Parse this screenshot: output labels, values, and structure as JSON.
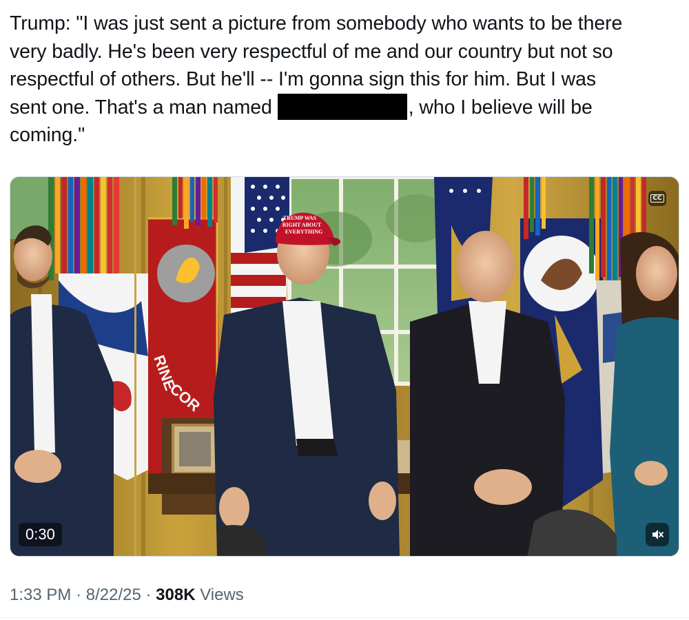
{
  "tweet": {
    "text_line1": "Trump: \"I was just sent a picture from somebody who wants to be there",
    "text_line2": "very badly. He's been very respectful of me and our country but not so",
    "text_line3": "respectful of others. But he'll -- I'm gonna sign this for him. But I was",
    "text_line4_before": "sent one. That's a man named",
    "text_line4_after": ", who I believe will be",
    "text_line5": "coming.\""
  },
  "media": {
    "video_time": "0:30",
    "cc_label": "CC",
    "cap_text_1": "TRUMP WAS",
    "cap_text_2": "RIGHT ABOUT",
    "cap_text_3": "EVERYTHING",
    "flag_text_1": "RINE",
    "flag_text_2": "COR",
    "colors": {
      "drape": "#b8912f",
      "suit_navy": "#1f2a44",
      "suit_black": "#1c1c22",
      "cap_red": "#c0132a",
      "trophy_gold": "#d9a22a",
      "marine_flag": "#b71c1c",
      "dress_teal": "#1d5f76"
    }
  },
  "meta": {
    "time": "1:33 PM",
    "separator1": "·",
    "date": "8/22/25",
    "separator2": "·",
    "views_count": "308K",
    "views_label": "Views"
  },
  "icons": {
    "cc": "closed-captions-icon",
    "mute": "speaker-muted-icon"
  }
}
